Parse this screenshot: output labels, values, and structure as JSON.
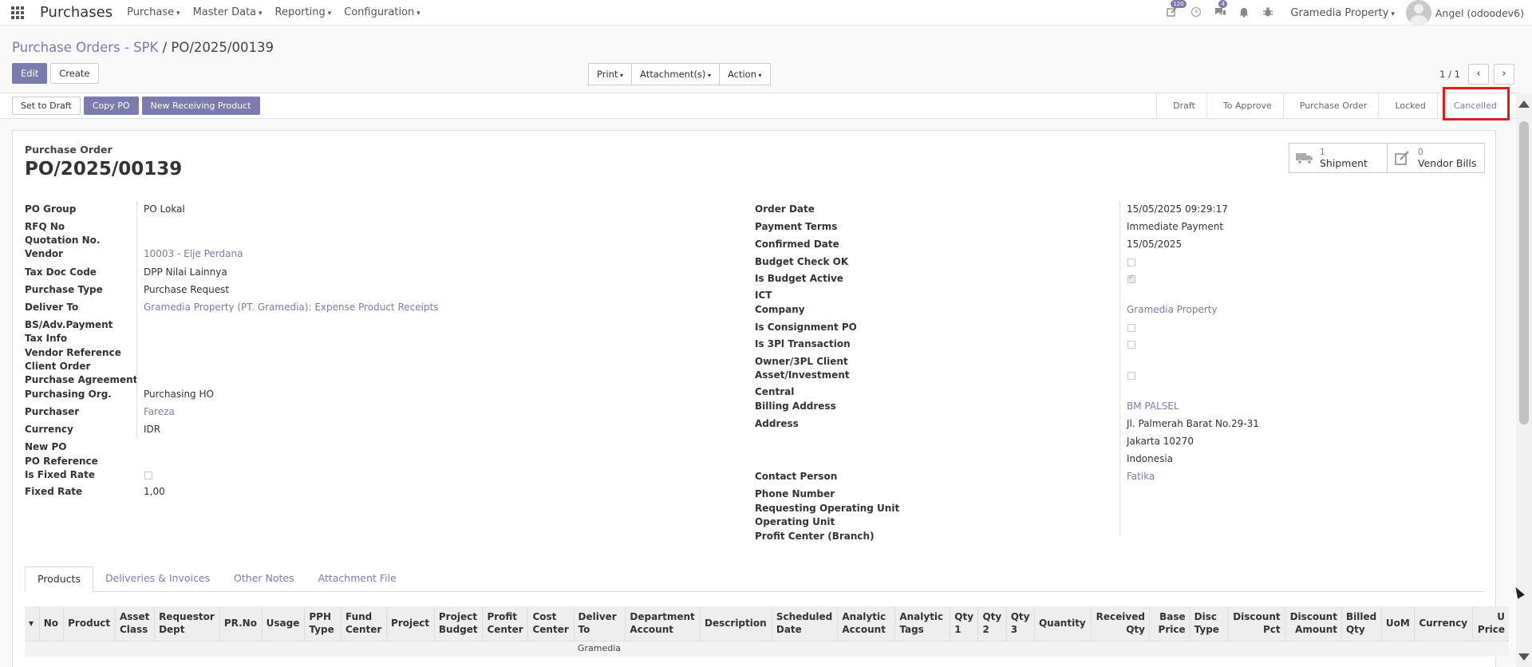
{
  "nav": {
    "app_name": "Purchases",
    "menus": [
      "Purchase",
      "Master Data",
      "Reporting",
      "Configuration"
    ],
    "badges": {
      "activity": "120",
      "messages": "4"
    },
    "company": "Gramedia Property",
    "user": "Angel (odoodev6)"
  },
  "breadcrumb": {
    "parent": "Purchase Orders - SPK",
    "separator": "/",
    "current": "PO/2025/00139"
  },
  "control": {
    "edit": "Edit",
    "create": "Create",
    "print": "Print",
    "attachments": "Attachment(s)",
    "action": "Action",
    "pager": "1 / 1"
  },
  "statusbar": {
    "set_to_draft": "Set to Draft",
    "copy_po": "Copy PO",
    "new_receiving": "New Receiving Product",
    "stages": [
      "Draft",
      "To Approve",
      "Purchase Order",
      "Locked",
      "Cancelled"
    ],
    "active_stage": "Cancelled"
  },
  "doc": {
    "subtitle": "Purchase Order",
    "title": "PO/2025/00139",
    "smart_buttons": [
      {
        "icon": "truck-icon",
        "count": "1",
        "label": "Shipment"
      },
      {
        "icon": "pencil-square-icon",
        "count": "0",
        "label": "Vendor Bills"
      }
    ]
  },
  "left_fields": [
    {
      "label": "PO Group",
      "value": "PO Lokal"
    },
    {
      "label": "RFQ No",
      "value": ""
    },
    {
      "label": "Quotation No.",
      "value": ""
    },
    {
      "label": "Vendor",
      "value": "10003 - Elje Perdana",
      "link": true
    },
    {
      "label": "Tax Doc Code",
      "value": "DPP Nilai Lainnya"
    },
    {
      "label": "Purchase Type",
      "value": "Purchase Request"
    },
    {
      "label": "Deliver To",
      "value": "Gramedia Property (PT. Gramedia): Expense Product Receipts",
      "link": true
    },
    {
      "label": "BS/Adv.Payment",
      "value": ""
    },
    {
      "label": "Tax Info",
      "value": ""
    },
    {
      "label": "Vendor Reference",
      "value": ""
    },
    {
      "label": "Client Order",
      "value": ""
    },
    {
      "label": "Purchase Agreement",
      "value": ""
    },
    {
      "label": "Purchasing Org.",
      "value": "Purchasing HO"
    },
    {
      "label": "Purchaser",
      "value": "Fareza",
      "link": true
    },
    {
      "label": "Currency",
      "value": "IDR"
    },
    {
      "label": "New PO",
      "value": ""
    },
    {
      "label": "PO Reference",
      "value": ""
    },
    {
      "label": "Is Fixed Rate",
      "value": "",
      "checkbox": false
    },
    {
      "label": "Fixed Rate",
      "value": "1,00"
    }
  ],
  "right_fields": [
    {
      "label": "Order Date",
      "value": "15/05/2025 09:29:17"
    },
    {
      "label": "Payment Terms",
      "value": "Immediate Payment"
    },
    {
      "label": "Confirmed Date",
      "value": "15/05/2025"
    },
    {
      "label": "Budget Check OK",
      "value": "",
      "checkbox": false
    },
    {
      "label": "Is Budget Active",
      "value": "",
      "checkbox": true
    },
    {
      "label": "ICT",
      "value": ""
    },
    {
      "label": "Company",
      "value": "Gramedia Property",
      "link": true
    },
    {
      "label": "Is Consignment PO",
      "value": "",
      "checkbox": false
    },
    {
      "label": "Is 3Pl Transaction",
      "value": "",
      "checkbox": false
    },
    {
      "label": "Owner/3PL Client",
      "value": ""
    },
    {
      "label": "Asset/Investment",
      "value": "",
      "checkbox": false
    },
    {
      "label": "Central",
      "value": ""
    },
    {
      "label": "Billing Address",
      "value": "BM PALSEL",
      "link": true
    },
    {
      "label": "Address",
      "value": "Jl. Palmerah Barat No.29-31"
    },
    {
      "label": "",
      "value": "Jakarta  10270"
    },
    {
      "label": "",
      "value": "Indonesia"
    },
    {
      "label": "Contact Person",
      "value": "Fatika",
      "link": true
    },
    {
      "label": "Phone Number",
      "value": ""
    },
    {
      "label": "Requesting Operating Unit",
      "value": ""
    },
    {
      "label": "Operating Unit",
      "value": ""
    },
    {
      "label": "Profit Center (Branch)",
      "value": ""
    }
  ],
  "tabs": [
    "Products",
    "Deliveries & Invoices",
    "Other Notes",
    "Attachment File"
  ],
  "table": {
    "columns": [
      "No",
      "Product",
      "Asset\nClass",
      "Requestor\nDept",
      "PR.No",
      "Usage",
      "PPH\nType",
      "Fund\nCenter",
      "Project",
      "Project\nBudget",
      "Profit\nCenter",
      "Cost\nCenter",
      "Deliver\nTo",
      "Department\nAccount",
      "Description",
      "Scheduled\nDate",
      "Analytic\nAccount",
      "Analytic\nTags",
      "Qty\n1",
      "Qty\n2",
      "Qty\n3",
      "Quantity",
      "Received\nQty",
      "Base\nPrice",
      "Disc\nType",
      "Discount\nPct",
      "Discount\nAmount",
      "Billed\nQty",
      "UoM",
      "Currency",
      "U\nPrice"
    ],
    "first_row_partial": "Gramedia"
  }
}
